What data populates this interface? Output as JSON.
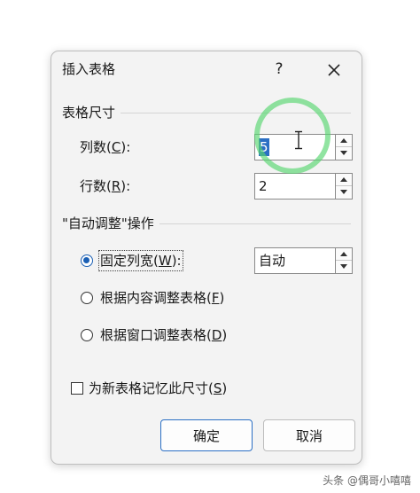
{
  "dialog": {
    "title": "插入表格",
    "help_glyph": "?",
    "close_glyph": "close"
  },
  "table_size": {
    "section_label": "表格尺寸",
    "columns": {
      "label_prefix": "列数(",
      "label_key": "C",
      "label_suffix": "):",
      "value": "5"
    },
    "rows": {
      "label_prefix": "行数(",
      "label_key": "R",
      "label_suffix": "):",
      "value": "2"
    }
  },
  "autofit": {
    "section_label": "\"自动调整\"操作",
    "fixed_width": {
      "label_prefix": "固定列宽(",
      "label_key": "W",
      "label_suffix": "):",
      "value": "自动",
      "checked": true
    },
    "fit_contents": {
      "label_prefix": "根据内容调整表格(",
      "label_key": "F",
      "label_suffix": ")"
    },
    "fit_window": {
      "label_prefix": "根据窗口调整表格(",
      "label_key": "D",
      "label_suffix": ")"
    }
  },
  "remember": {
    "label_prefix": "为新表格记忆此尺寸(",
    "label_key": "S",
    "label_suffix": ")",
    "checked": false
  },
  "buttons": {
    "ok": "确定",
    "cancel": "取消"
  },
  "watermark": "头条 @偶哥小嘻嘻",
  "colors": {
    "accent": "#2b6fc4",
    "cursor_highlight": "#56d66e"
  }
}
